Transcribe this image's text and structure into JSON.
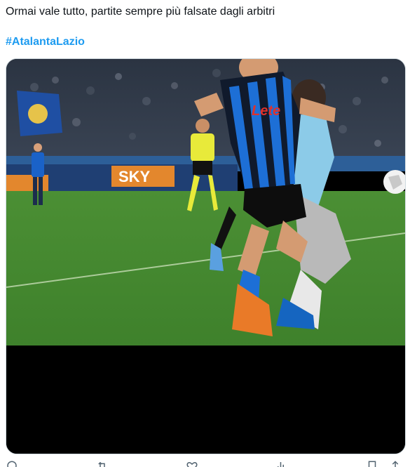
{
  "tweet": {
    "text": "Ormai vale tutto, partite sempre più falsate dagli arbitri",
    "hashtag": "#AtalantaLazio"
  },
  "media": {
    "type": "video-still",
    "description_icon": "video-frame",
    "sponsor_text": "Lete",
    "board_text": "SKY"
  },
  "actions": [
    {
      "icon": "reply-icon"
    },
    {
      "icon": "retweet-icon"
    },
    {
      "icon": "like-icon"
    },
    {
      "icon": "views-icon"
    },
    {
      "icon": "bookmark-icon"
    },
    {
      "icon": "share-icon"
    }
  ],
  "colors": {
    "text": "#0f1419",
    "link": "#1d9bf0",
    "border": "#cfd9de",
    "pitch": "#3f8a2e",
    "atalanta_blue": "#1565c0",
    "lazio_sky": "#8ccbe8"
  }
}
